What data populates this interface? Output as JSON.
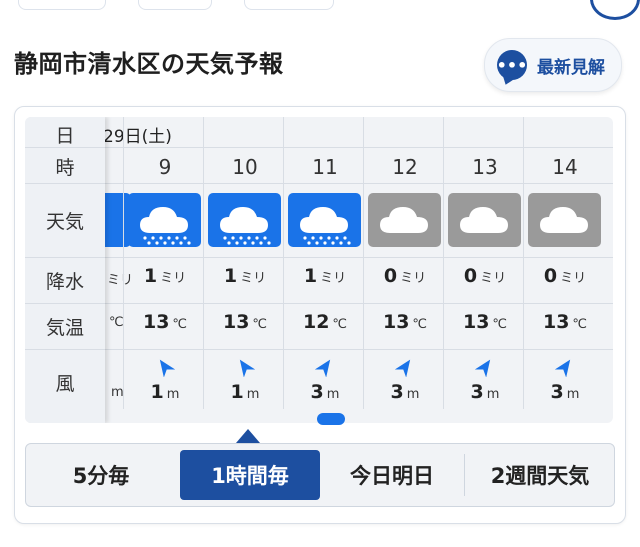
{
  "header": {
    "title": "静岡市清水区の天気予報",
    "latest_button": "最新見解",
    "latest_icon_glyph": "•••"
  },
  "table": {
    "date_label": "日",
    "date_value": "29日(土)",
    "row_labels": {
      "hour": "時",
      "weather": "天気",
      "precip": "降水",
      "temp": "気温",
      "wind": "風"
    },
    "partial_column": {
      "precip_unit": "ミリ",
      "temp_unit": "℃",
      "wind_unit": "m"
    },
    "columns": [
      {
        "hour": "9",
        "weather": "rain",
        "precip": "1",
        "precip_unit": "ミリ",
        "temp": "13",
        "temp_unit": "℃",
        "wind_dir": "ne",
        "wind": "1",
        "wind_unit": "m"
      },
      {
        "hour": "10",
        "weather": "rain",
        "precip": "1",
        "precip_unit": "ミリ",
        "temp": "13",
        "temp_unit": "℃",
        "wind_dir": "ne",
        "wind": "1",
        "wind_unit": "m"
      },
      {
        "hour": "11",
        "weather": "rain",
        "precip": "1",
        "precip_unit": "ミリ",
        "temp": "12",
        "temp_unit": "℃",
        "wind_dir": "nw",
        "wind": "3",
        "wind_unit": "m"
      },
      {
        "hour": "12",
        "weather": "cloudy",
        "precip": "0",
        "precip_unit": "ミリ",
        "temp": "13",
        "temp_unit": "℃",
        "wind_dir": "nw",
        "wind": "3",
        "wind_unit": "m"
      },
      {
        "hour": "13",
        "weather": "cloudy",
        "precip": "0",
        "precip_unit": "ミリ",
        "temp": "13",
        "temp_unit": "℃",
        "wind_dir": "nw",
        "wind": "3",
        "wind_unit": "m"
      },
      {
        "hour": "14",
        "weather": "cloudy",
        "precip": "0",
        "precip_unit": "ミリ",
        "temp": "13",
        "temp_unit": "℃",
        "wind_dir": "nw",
        "wind": "3",
        "wind_unit": "m"
      }
    ]
  },
  "tabs": [
    {
      "label": "5分毎",
      "active": false
    },
    {
      "label": "1時間毎",
      "active": true
    },
    {
      "label": "今日明日",
      "active": false
    },
    {
      "label": "2週間天気",
      "active": false
    }
  ],
  "colors": {
    "brand": "#1d4fa0",
    "rain_icon_bg": "#1a73e8",
    "cloud_icon_bg": "#9a9a9a",
    "wind_arrow": "#1a73e8"
  },
  "icons": {
    "rain": "rain-cloud-icon",
    "cloudy": "cloud-icon",
    "latest": "speech-bubble-icon",
    "wind": "wind-arrow-icon"
  }
}
